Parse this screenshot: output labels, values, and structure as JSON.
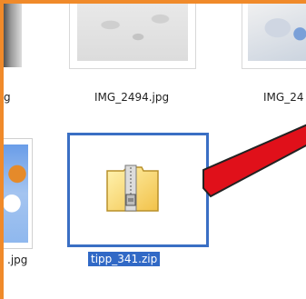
{
  "files": [
    {
      "name": "g",
      "type": "image",
      "selected": false
    },
    {
      "name": "IMG_2494.jpg",
      "type": "image",
      "selected": false
    },
    {
      "name": "IMG_24",
      "type": "image",
      "selected": false
    },
    {
      "name": ".jpg",
      "type": "image",
      "selected": false
    },
    {
      "name": "tipp_341.zip",
      "type": "zip-archive",
      "selected": true
    }
  ],
  "colors": {
    "frame_border": "#f08a2a",
    "selection_border": "#3a6fc4",
    "selection_label_bg": "#3169c6",
    "arrow_fill": "#e0101a"
  },
  "icons": {
    "zip_file": "zip-folder-icon",
    "pointer_arrow": "red-arrow-annotation"
  }
}
